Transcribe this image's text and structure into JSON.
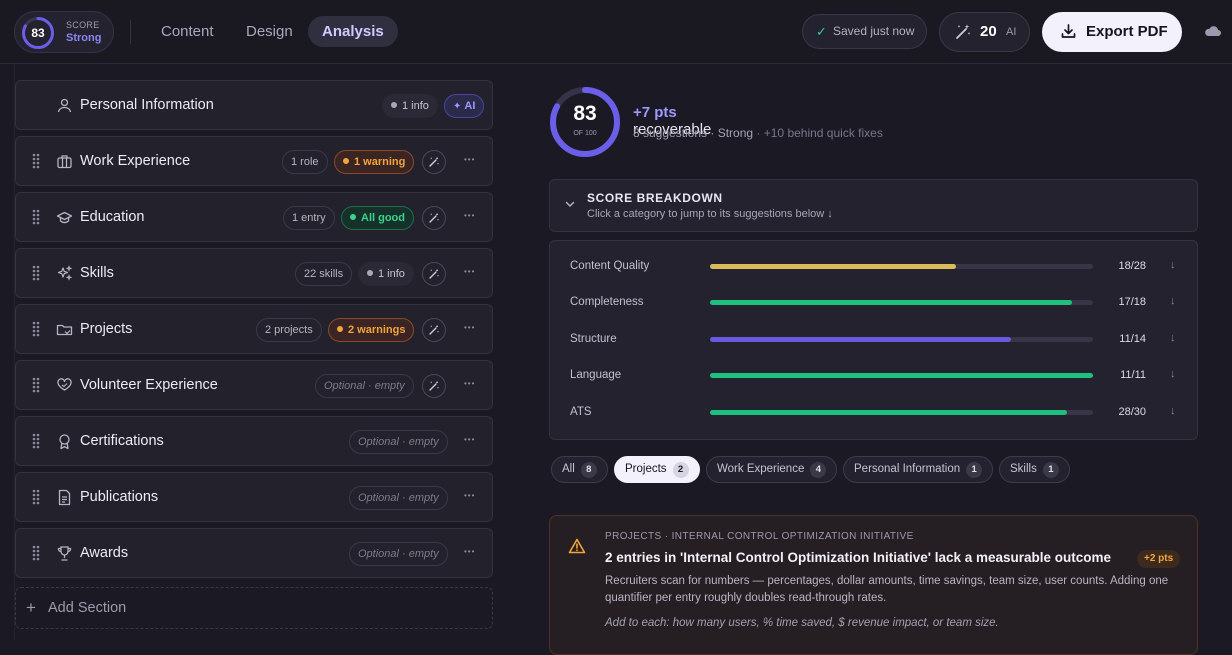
{
  "header": {
    "score": "83",
    "score_label": "SCORE",
    "score_word": "Strong",
    "tabs": [
      {
        "label": "Content"
      },
      {
        "label": "Design"
      },
      {
        "label": "Analysis"
      }
    ],
    "saved_label": "Saved just now",
    "ai_credits": "20",
    "ai_label": "AI",
    "export_label": "Export PDF"
  },
  "sections": [
    {
      "title": "Personal Information",
      "icon": "person-icon",
      "badges": [
        {
          "text": "1 info",
          "kind": "info"
        },
        {
          "text": "AI",
          "kind": "ai"
        }
      ]
    },
    {
      "title": "Work Experience",
      "icon": "briefcase-icon",
      "badges": [
        {
          "text": "1 role",
          "kind": "plain"
        },
        {
          "text": "1 warning",
          "kind": "warn"
        }
      ]
    },
    {
      "title": "Education",
      "icon": "graduation-cap-icon",
      "badges": [
        {
          "text": "1 entry",
          "kind": "plain"
        },
        {
          "text": "All good",
          "kind": "good"
        }
      ]
    },
    {
      "title": "Skills",
      "icon": "sparkles-icon",
      "badges": [
        {
          "text": "22 skills",
          "kind": "plain"
        },
        {
          "text": "1 info",
          "kind": "info"
        }
      ]
    },
    {
      "title": "Projects",
      "icon": "folder-icon",
      "badges": [
        {
          "text": "2 projects",
          "kind": "plain"
        },
        {
          "text": "2 warnings",
          "kind": "warn"
        }
      ]
    },
    {
      "title": "Volunteer Experience",
      "icon": "heart-hand-icon",
      "badges": [
        {
          "text": "Optional · empty",
          "kind": "opt"
        }
      ]
    },
    {
      "title": "Certifications",
      "icon": "award-icon",
      "badges": [
        {
          "text": "Optional · empty",
          "kind": "opt"
        }
      ]
    },
    {
      "title": "Publications",
      "icon": "document-icon",
      "badges": [
        {
          "text": "Optional · empty",
          "kind": "opt"
        }
      ]
    },
    {
      "title": "Awards",
      "icon": "trophy-icon",
      "badges": [
        {
          "text": "Optional · empty",
          "kind": "opt"
        }
      ]
    }
  ],
  "add_section_label": "Add Section",
  "analysis": {
    "score": "83",
    "score_of": "OF 100",
    "recoverable_pts": "+7 pts",
    "recoverable_label": "recoverable",
    "suggestions_text": "8 suggestions · Strong",
    "suggestions_extra": "· +10 behind quick fixes",
    "breakdown_title": "SCORE BREAKDOWN",
    "breakdown_subtitle": "Click a category to jump to its suggestions below ↓",
    "breakdown": [
      {
        "name": "Content Quality",
        "value": "18/28",
        "fraction": 0.643,
        "color": "#d9bd5c"
      },
      {
        "name": "Completeness",
        "value": "17/18",
        "fraction": 0.944,
        "color": "#1fbf7f"
      },
      {
        "name": "Structure",
        "value": "11/14",
        "fraction": 0.786,
        "color": "#6a5ae0"
      },
      {
        "name": "Language",
        "value": "11/11",
        "fraction": 1.0,
        "color": "#1fbf7f"
      },
      {
        "name": "ATS",
        "value": "28/30",
        "fraction": 0.933,
        "color": "#1fbf7f"
      }
    ],
    "filters": [
      {
        "label": "All",
        "count": "8"
      },
      {
        "label": "Projects",
        "count": "2"
      },
      {
        "label": "Work Experience",
        "count": "4"
      },
      {
        "label": "Personal Information",
        "count": "1"
      },
      {
        "label": "Skills",
        "count": "1"
      }
    ],
    "card": {
      "category": "PROJECTS · INTERNAL CONTROL OPTIMIZATION INITIATIVE",
      "title": "2 entries in 'Internal Control Optimization Initiative' lack a measurable outcome",
      "points": "+2 pts",
      "body": "Recruiters scan for numbers — percentages, dollar amounts, time savings, team size, user counts. Adding one quantifier per entry roughly doubles read-through rates.",
      "hint": "Add to each: how many users, % time saved, $ revenue impact, or team size."
    }
  },
  "colors": {
    "accent": "#7a6ff0",
    "warning": "#f2a53a",
    "good": "#39d48d"
  }
}
